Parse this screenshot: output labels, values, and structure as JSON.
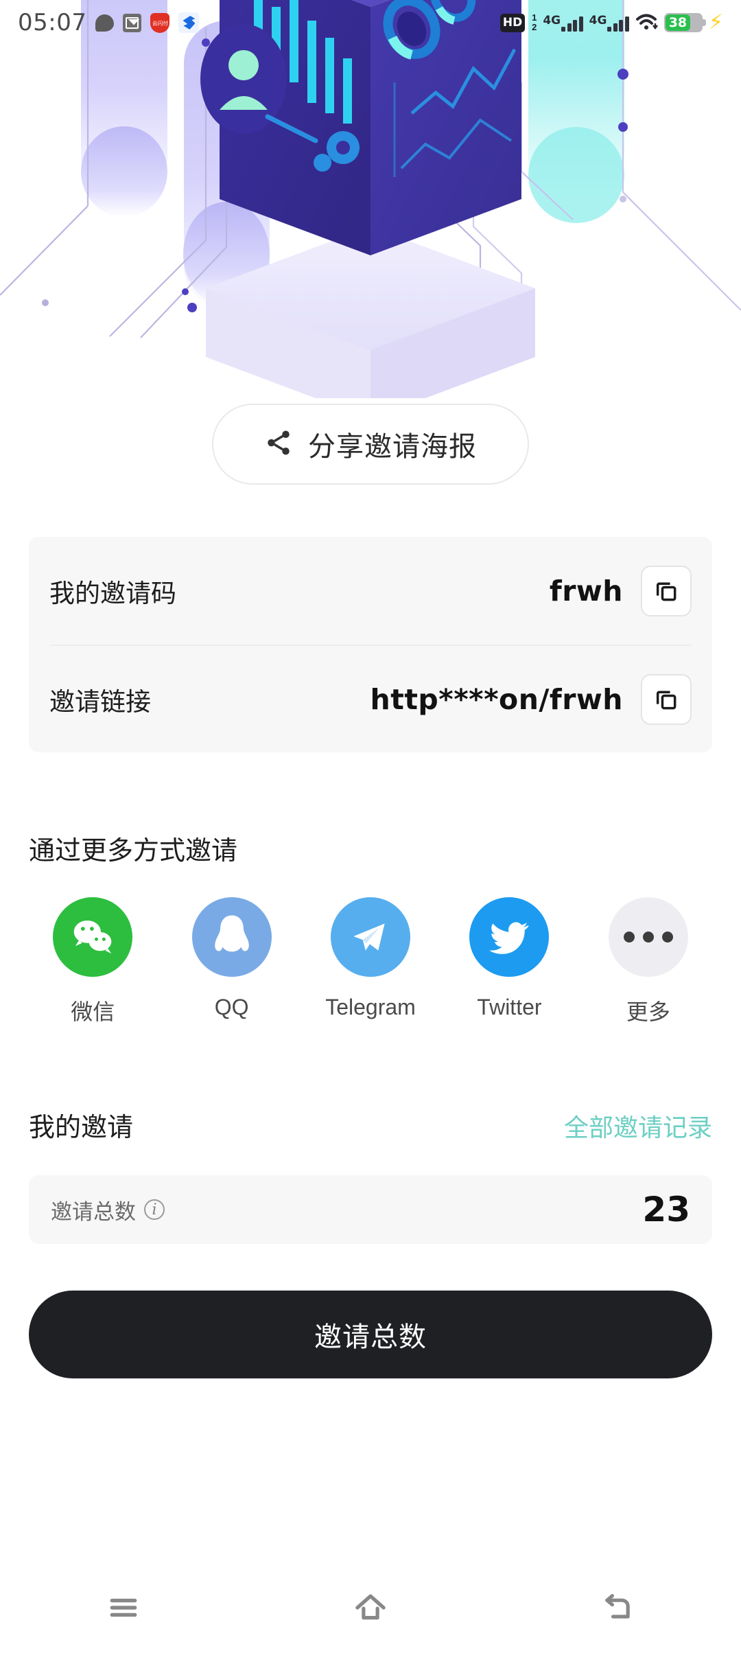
{
  "status_bar": {
    "time": "05:07",
    "icons": [
      "chat-bubble-icon",
      "mail-icon",
      "red-app-icon",
      "blue-app-icon"
    ],
    "red_app_text": "云闪付",
    "volte_label": "HD",
    "sim1_label": "1",
    "sim2_label": "2",
    "network_1": "4G",
    "network_2": "4G",
    "wifi": "wifi-icon",
    "battery_percent": "38",
    "charging": true,
    "battery_color": "#2bbf4e"
  },
  "hero": {
    "illustration_name": "isometric-data-cube-illustration"
  },
  "poster_button": {
    "label": "分享邀请海报",
    "icon": "share-nodes-icon"
  },
  "invite_card": {
    "rows": [
      {
        "key": "我的邀请码",
        "value": "frwh",
        "action_icon": "copy-icon"
      },
      {
        "key": "邀请链接",
        "value": "http****on/frwh",
        "action_icon": "copy-icon"
      }
    ]
  },
  "share_section": {
    "title": "通过更多方式邀请",
    "methods": [
      {
        "label": "微信",
        "icon": "wechat-icon",
        "color": "#2dbe3f"
      },
      {
        "label": "QQ",
        "icon": "qq-icon",
        "color": "#7aaae6"
      },
      {
        "label": "Telegram",
        "icon": "telegram-icon",
        "color": "#56aeee"
      },
      {
        "label": "Twitter",
        "icon": "twitter-icon",
        "color": "#1d9bf0"
      },
      {
        "label": "更多",
        "icon": "more-dots-icon",
        "color": "#eeeef2"
      }
    ]
  },
  "my_invites": {
    "title": "我的邀请",
    "all_records_link": "全部邀请记录",
    "link_color": "#6dcfc4",
    "stat": {
      "label": "邀请总数",
      "info_icon": "info-icon",
      "value": "23"
    }
  },
  "cta_button": {
    "label": "邀请总数",
    "background": "#1f2024"
  },
  "nav_bar": {
    "buttons": [
      {
        "name": "recents-icon"
      },
      {
        "name": "home-icon"
      },
      {
        "name": "back-icon"
      }
    ],
    "color": "#888888"
  }
}
